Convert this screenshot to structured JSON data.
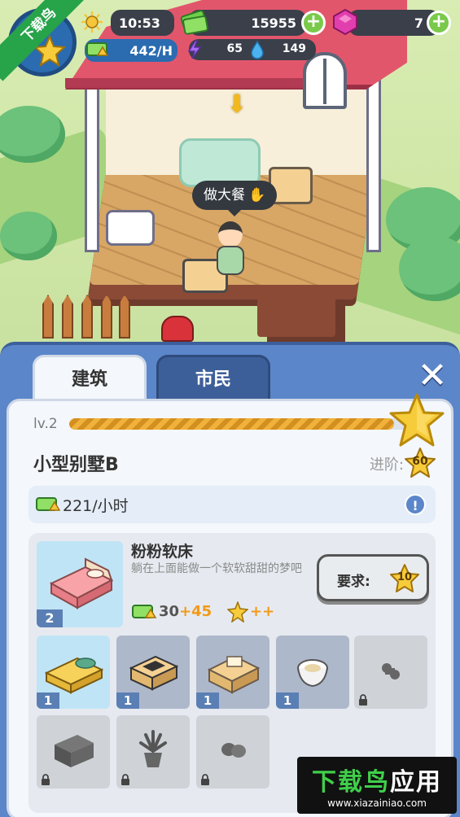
{
  "hud": {
    "time": "10:53",
    "cash": "15955",
    "gems": "7",
    "income_rate": "442/H",
    "energy": "65",
    "water": "149"
  },
  "scene": {
    "speech_bubble": "做大餐"
  },
  "watermark": {
    "corner": "下载鸟",
    "title_left": "下载鸟",
    "title_right": "应用",
    "url": "www.xiazainiao.com"
  },
  "panel": {
    "tabs": [
      {
        "label": "建筑"
      },
      {
        "label": "市民"
      }
    ],
    "level_label": "lv.2",
    "level_progress": 0.95,
    "building_name": "小型别墅B",
    "advance_label": "进阶:",
    "advance_requirement": "60",
    "income": "221/小时",
    "featured": {
      "name": "粉粉软床",
      "description": "躺在上面能做一个软软甜甜的梦吧",
      "count": "2",
      "base_income": "30",
      "bonus_income": "+45",
      "star_bonus": "++",
      "require_label": "要求:",
      "require_value": "10"
    },
    "slots": [
      {
        "item": "yellow-bed",
        "count": "1",
        "locked": false,
        "bg": "#bfe4f5"
      },
      {
        "item": "stove",
        "count": "1",
        "locked": false,
        "bg": "#aeb8cb"
      },
      {
        "item": "desk",
        "count": "1",
        "locked": false,
        "bg": "#aeb8cb"
      },
      {
        "item": "toilet",
        "count": "1",
        "locked": false,
        "bg": "#aeb8cb"
      },
      {
        "item": "lamp",
        "count": "",
        "locked": true,
        "bg": "#cfd3d8"
      },
      {
        "item": "tv-cabinet",
        "count": "",
        "locked": true,
        "bg": "#cfd3d8"
      },
      {
        "item": "potted-plant",
        "count": "",
        "locked": true,
        "bg": "#cfd3d8"
      },
      {
        "item": "armchair",
        "count": "",
        "locked": true,
        "bg": "#cfd3d8"
      }
    ]
  },
  "colors": {
    "panel_blue": "#5b86c9",
    "accent_orange": "#f29a17",
    "plus_green": "#7ac94a",
    "gem_pink": "#e23fae"
  }
}
